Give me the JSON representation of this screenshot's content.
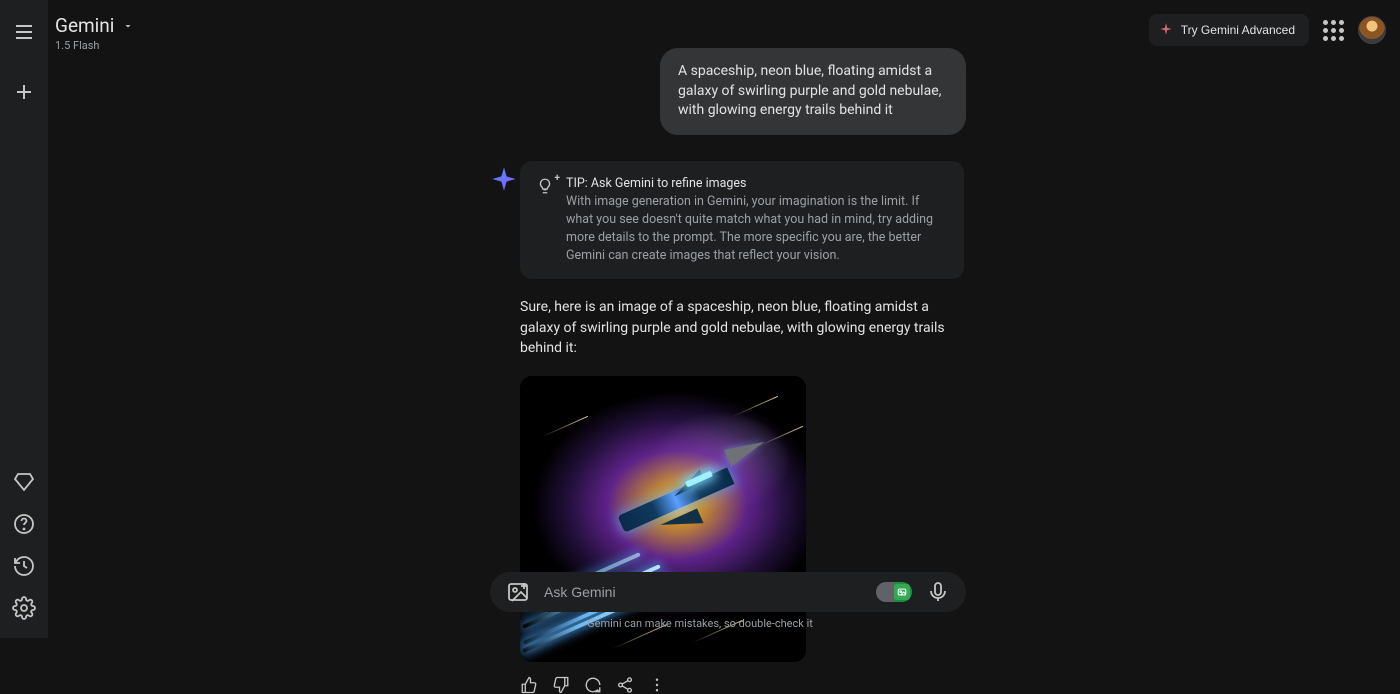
{
  "header": {
    "title": "Gemini",
    "model": "1.5 Flash",
    "try_advanced": "Try Gemini Advanced"
  },
  "user_message": "A spaceship, neon blue, floating amidst a galaxy of swirling purple and gold nebulae, with glowing energy trails behind it",
  "tip": {
    "title": "TIP: Ask Gemini to refine images",
    "body": "With image generation in Gemini, your imagination is the limit. If what you see doesn't quite match what you had in mind, try adding more details to the prompt. The more specific you are, the better Gemini can create images that reflect your vision."
  },
  "assistant_text": "Sure, here is an image of a spaceship, neon blue, floating amidst a galaxy of swirling purple and gold nebulae, with glowing energy trails behind it:",
  "composer": {
    "placeholder": "Ask Gemini"
  },
  "disclaimer": "Gemini can make mistakes, so double-check it",
  "image": {
    "alt": "spaceship-neon-blue-nebula"
  }
}
